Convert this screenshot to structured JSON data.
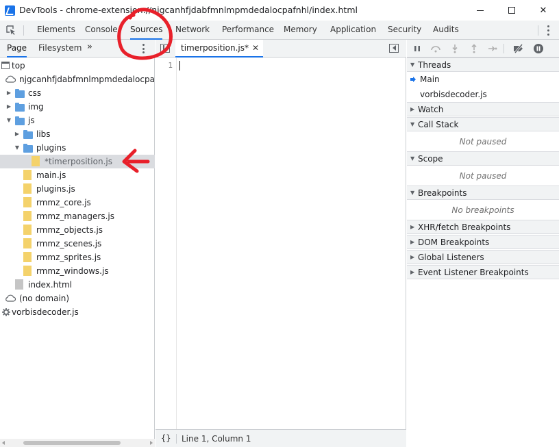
{
  "window": {
    "title": "DevTools - chrome-extension://njgcanhfjdabfmnlmpmdedalocpafnhl/index.html",
    "controls": {
      "minimize": "",
      "maximize": "",
      "close": "✕"
    }
  },
  "main_tabs": [
    {
      "label": "Elements"
    },
    {
      "label": "Console"
    },
    {
      "label": "Sources",
      "selected": true
    },
    {
      "label": "Network"
    },
    {
      "label": "Performance"
    },
    {
      "label": "Memory"
    },
    {
      "label": "Application"
    },
    {
      "label": "Security"
    },
    {
      "label": "Audits"
    }
  ],
  "navigator": {
    "tabs": [
      {
        "label": "Page",
        "selected": true
      },
      {
        "label": "Filesystem"
      }
    ],
    "more": "»",
    "tree": [
      {
        "label": "top",
        "type": "frame"
      },
      {
        "label": "njgcanhfjdabfmnlmpmdedalocpafnhl",
        "type": "cloud"
      },
      {
        "label": "css",
        "type": "folder"
      },
      {
        "label": "img",
        "type": "folder"
      },
      {
        "label": "js",
        "type": "folder"
      },
      {
        "label": "libs",
        "type": "folder"
      },
      {
        "label": "plugins",
        "type": "folder"
      },
      {
        "label": "*timerposition.js",
        "type": "file",
        "selected": true
      },
      {
        "label": "main.js",
        "type": "file"
      },
      {
        "label": "plugins.js",
        "type": "file"
      },
      {
        "label": "rmmz_core.js",
        "type": "file"
      },
      {
        "label": "rmmz_managers.js",
        "type": "file"
      },
      {
        "label": "rmmz_objects.js",
        "type": "file"
      },
      {
        "label": "rmmz_scenes.js",
        "type": "file"
      },
      {
        "label": "rmmz_sprites.js",
        "type": "file"
      },
      {
        "label": "rmmz_windows.js",
        "type": "file"
      },
      {
        "label": "index.html",
        "type": "html"
      },
      {
        "label": "(no domain)",
        "type": "cloud"
      },
      {
        "label": "vorbisdecoder.js",
        "type": "worker"
      }
    ]
  },
  "editor": {
    "tab_label": "timerposition.js*",
    "tab_close": "✕",
    "line_number": "1",
    "pretty_print": "{}",
    "status": "Line 1, Column 1"
  },
  "debugger": {
    "threads": {
      "header": "Threads",
      "items": [
        "Main",
        "vorbisdecoder.js"
      ]
    },
    "watch": {
      "header": "Watch"
    },
    "call_stack": {
      "header": "Call Stack",
      "message": "Not paused"
    },
    "scope": {
      "header": "Scope",
      "message": "Not paused"
    },
    "breakpoints": {
      "header": "Breakpoints",
      "message": "No breakpoints"
    },
    "xhr": {
      "header": "XHR/fetch Breakpoints"
    },
    "dom": {
      "header": "DOM Breakpoints"
    },
    "global": {
      "header": "Global Listeners"
    },
    "event": {
      "header": "Event Listener Breakpoints"
    }
  },
  "colors": {
    "accent": "#1a73e8",
    "annotation": "#e8202a",
    "folder": "#5e9fe0",
    "file": "#f4d26b"
  }
}
